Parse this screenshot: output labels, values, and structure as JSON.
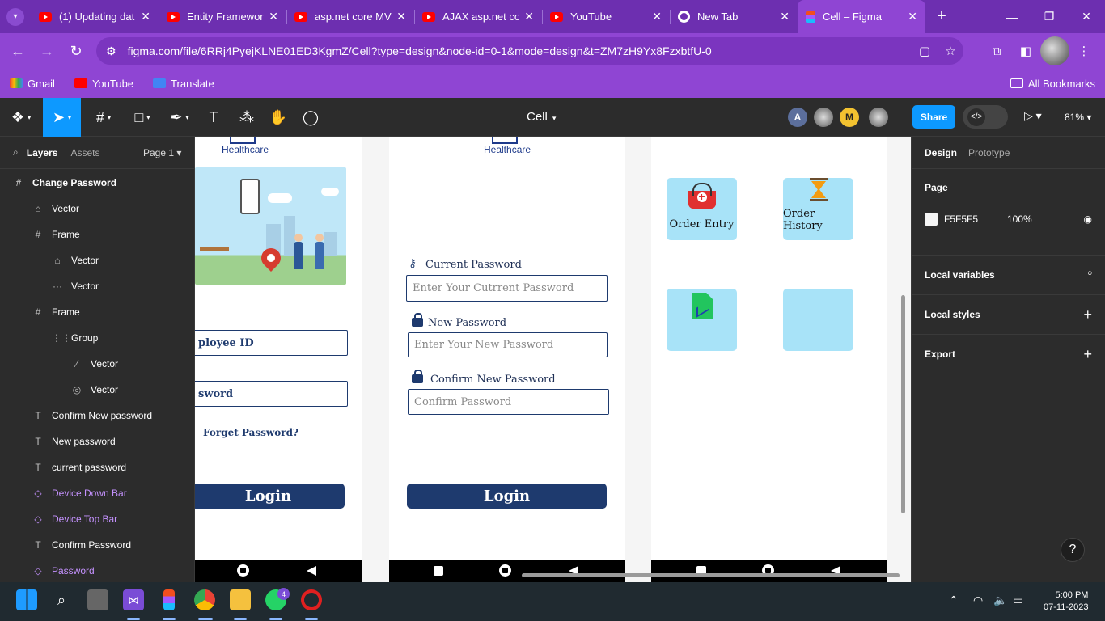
{
  "browser": {
    "tabs": [
      {
        "title": "(1) Updating dat",
        "icon": "youtube-icon"
      },
      {
        "title": "Entity Framewor",
        "icon": "youtube-icon"
      },
      {
        "title": "asp.net core MV",
        "icon": "youtube-icon"
      },
      {
        "title": "AJAX asp.net co",
        "icon": "youtube-icon"
      },
      {
        "title": "YouTube",
        "icon": "youtube-icon"
      },
      {
        "title": "New Tab",
        "icon": "chrome-icon"
      },
      {
        "title": "Cell – Figma",
        "icon": "figma-icon",
        "active": true
      }
    ],
    "url": "figma.com/file/6RRj4PyejKLNE01ED3KgmZ/Cell?type=design&node-id=0-1&mode=design&t=ZM7zH9Yx8FzxbtfU-0",
    "bookmarks": [
      "Gmail",
      "YouTube",
      "Translate"
    ],
    "all_bookmarks": "All Bookmarks",
    "accent": "#8f45d3"
  },
  "figma": {
    "file_title": "Cell",
    "share_label": "Share",
    "zoom": "81%",
    "avatars": [
      "A",
      "M"
    ],
    "left_tabs": {
      "layers": "Layers",
      "assets": "Assets",
      "page": "Page 1"
    },
    "layers": [
      {
        "name": "Change Password",
        "icon": "frame-icon",
        "indent": 0,
        "bold": true,
        "component": false
      },
      {
        "name": "Vector",
        "icon": "vector-icon",
        "indent": 1,
        "bold": false,
        "component": false
      },
      {
        "name": "Frame",
        "icon": "frame-icon",
        "indent": 1,
        "bold": false,
        "component": false
      },
      {
        "name": "Vector",
        "icon": "vector-icon",
        "indent": 2,
        "bold": false,
        "component": false
      },
      {
        "name": "Vector",
        "icon": "vector-dots-icon",
        "indent": 2,
        "bold": false,
        "component": false
      },
      {
        "name": "Frame",
        "icon": "frame-icon",
        "indent": 1,
        "bold": false,
        "component": false
      },
      {
        "name": "Group",
        "icon": "group-icon",
        "indent": 2,
        "bold": false,
        "component": false
      },
      {
        "name": "Vector",
        "icon": "vector-line-icon",
        "indent": 3,
        "bold": false,
        "component": false
      },
      {
        "name": "Vector",
        "icon": "vector-circle-icon",
        "indent": 3,
        "bold": false,
        "component": false
      },
      {
        "name": "Confirm New password",
        "icon": "text-icon",
        "indent": 1,
        "bold": false,
        "component": false
      },
      {
        "name": "New password",
        "icon": "text-icon",
        "indent": 1,
        "bold": false,
        "component": false
      },
      {
        "name": "current password",
        "icon": "text-icon",
        "indent": 1,
        "bold": false,
        "component": false
      },
      {
        "name": "Device Down Bar",
        "icon": "component-icon",
        "indent": 1,
        "bold": false,
        "component": true
      },
      {
        "name": "Device Top Bar",
        "icon": "component-icon",
        "indent": 1,
        "bold": false,
        "component": true
      },
      {
        "name": "Confirm Password",
        "icon": "text-icon",
        "indent": 1,
        "bold": false,
        "component": false
      },
      {
        "name": "Password",
        "icon": "component-icon",
        "indent": 1,
        "bold": false,
        "component": true
      }
    ],
    "right_tabs": {
      "design": "Design",
      "prototype": "Prototype"
    },
    "page_section": {
      "title": "Page",
      "color_hex": "F5F5F5",
      "opacity": "100%"
    },
    "sections": [
      "Local variables",
      "Local styles",
      "Export"
    ]
  },
  "canvas": {
    "login_frame": {
      "logo": "Healthcare",
      "employee_field": "ployee ID",
      "password_field": "sword",
      "forget": "Forget Password?",
      "login": "Login"
    },
    "change_password_frame": {
      "logo": "Healthcare",
      "current_label": "Current Password",
      "current_placeholder": "Enter Your Cutrrent Password",
      "new_label": "New Password",
      "new_placeholder": "Enter Your New Password",
      "confirm_label": "Confirm New Password",
      "confirm_placeholder": "Confirm Password",
      "login": "Login"
    },
    "menu_frame": {
      "tiles": [
        "Order Entry",
        "Order History",
        "",
        ""
      ]
    },
    "frame_bg": "#ffffff",
    "primary_color": "#1e3a6e",
    "tile_color": "#a8e3f8"
  },
  "taskbar": {
    "whatsapp_badge": "4",
    "time": "5:00 PM",
    "date": "07-11-2023"
  }
}
